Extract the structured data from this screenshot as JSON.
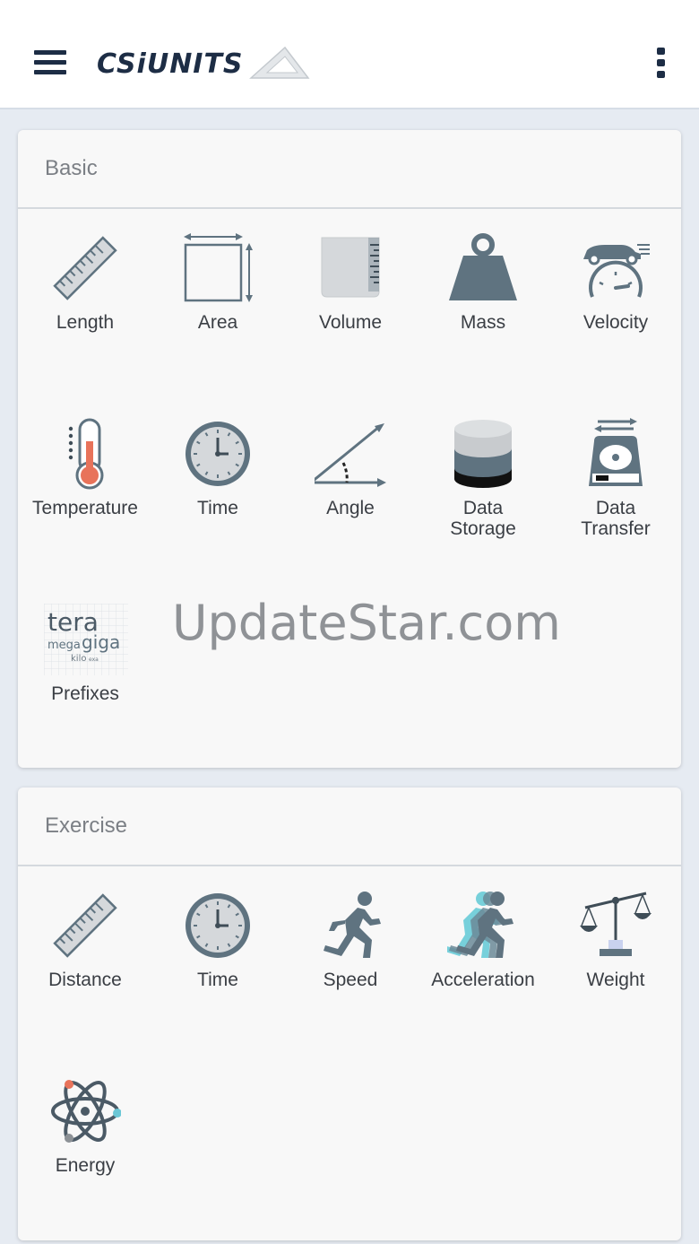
{
  "appbar": {
    "logo_text": "CSiUNITS",
    "menu_icon": "hamburger-menu-icon",
    "more_icon": "more-vert-icon"
  },
  "sections": [
    {
      "title": "Basic",
      "items": [
        {
          "label": "Length",
          "icon": "ruler-icon"
        },
        {
          "label": "Area",
          "icon": "area-square-icon"
        },
        {
          "label": "Volume",
          "icon": "beaker-icon"
        },
        {
          "label": "Mass",
          "icon": "weight-icon"
        },
        {
          "label": "Velocity",
          "icon": "speedometer-car-icon"
        },
        {
          "label": "Temperature",
          "icon": "thermometer-icon"
        },
        {
          "label": "Time",
          "icon": "clock-icon"
        },
        {
          "label": "Angle",
          "icon": "angle-icon"
        },
        {
          "label": "Data\nStorage",
          "icon": "database-icon"
        },
        {
          "label": "Data\nTransfer",
          "icon": "hard-drive-transfer-icon"
        },
        {
          "label": "Prefixes",
          "icon": "prefixes-wordcloud-icon",
          "icon_words": [
            "tera",
            "mega",
            "giga",
            "kilo",
            "exa"
          ]
        }
      ]
    },
    {
      "title": "Exercise",
      "items": [
        {
          "label": "Distance",
          "icon": "ruler-icon"
        },
        {
          "label": "Time",
          "icon": "clock-icon"
        },
        {
          "label": "Speed",
          "icon": "runner-icon"
        },
        {
          "label": "Acceleration",
          "icon": "runner-motion-icon"
        },
        {
          "label": "Weight",
          "icon": "balance-scale-icon"
        },
        {
          "label": "Energy",
          "icon": "atom-icon"
        }
      ]
    }
  ],
  "watermark": "UpdateStar.com",
  "colors": {
    "icon_primary": "#5f7380",
    "icon_light": "#d5d8db",
    "thermo_red": "#e8735a",
    "accel_cyan": "#4cc3d1",
    "atom_orange": "#e8735a",
    "atom_cyan": "#6bc7d6",
    "logo_navy": "#1d2d45"
  }
}
